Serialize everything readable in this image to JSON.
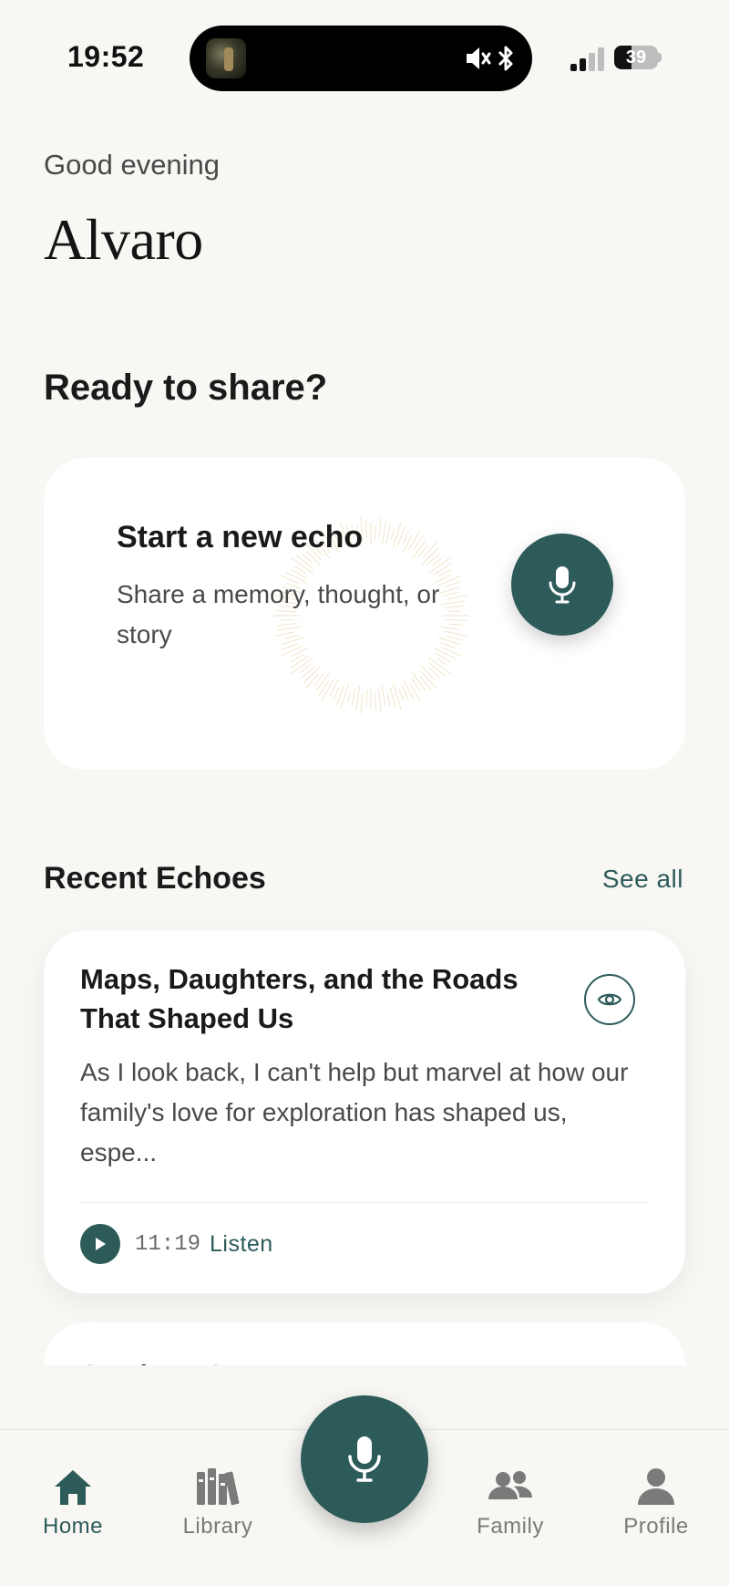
{
  "status_bar": {
    "time": "19:52",
    "battery": "39",
    "battery_level": 0.39
  },
  "greeting": {
    "salutation": "Good evening",
    "name": "Alvaro"
  },
  "prompt_section": {
    "heading": "Ready to share?"
  },
  "start_card": {
    "title": "Start a new echo",
    "subtitle": "Share a memory, thought, or story"
  },
  "recent": {
    "heading": "Recent Echoes",
    "see_all": "See all",
    "items": [
      {
        "title": "Maps, Daughters, and the Roads That Shaped Us",
        "excerpt": "As I look back, I can't help but marvel at how our family's love for exploration has shaped us, espe...",
        "duration": "11:19",
        "listen": "Listen"
      },
      {
        "title": "Seeds to Sustenance: A"
      }
    ]
  },
  "tabs": [
    {
      "label": "Home",
      "icon": "home-icon",
      "active": true
    },
    {
      "label": "Library",
      "icon": "library-icon",
      "active": false
    },
    {
      "label": "Family",
      "icon": "family-icon",
      "active": false
    },
    {
      "label": "Profile",
      "icon": "profile-icon",
      "active": false
    }
  ],
  "colors": {
    "accent": "#2d5b5a",
    "background": "#f8f7f4",
    "card": "#ffffff"
  }
}
